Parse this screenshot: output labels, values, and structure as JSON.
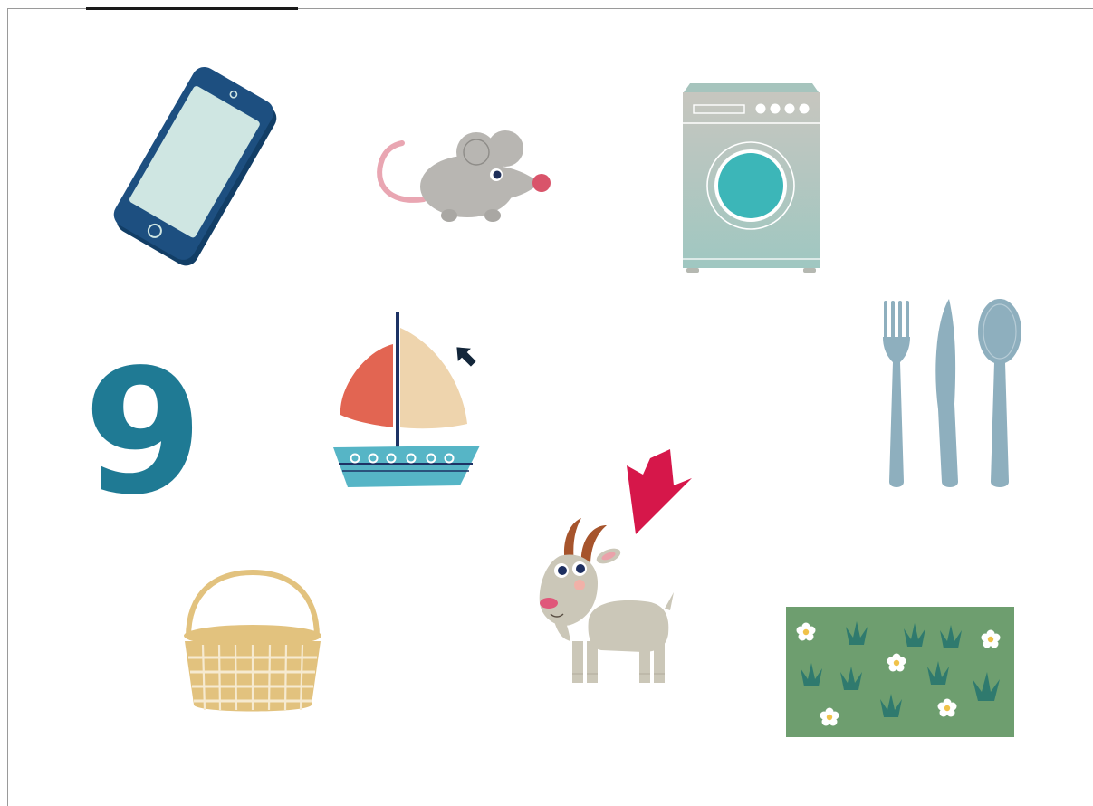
{
  "number_card": {
    "digit": "9"
  },
  "pictures": [
    {
      "name": "smartphone",
      "icon": "smartphone-icon"
    },
    {
      "name": "mouse",
      "icon": "mouse-icon"
    },
    {
      "name": "washing-machine",
      "icon": "washing-machine-icon"
    },
    {
      "name": "sailboat",
      "icon": "sailboat-icon"
    },
    {
      "name": "cutlery",
      "icon": "cutlery-icon"
    },
    {
      "name": "goat",
      "icon": "goat-icon"
    },
    {
      "name": "basket",
      "icon": "basket-icon"
    },
    {
      "name": "grass-meadow",
      "icon": "grass-meadow-icon"
    }
  ],
  "pointers": [
    {
      "name": "sail-pointer",
      "color": "#13263a"
    },
    {
      "name": "goat-pointer",
      "color": "#d6174a"
    }
  ],
  "colors": {
    "digit": "#1f7a94",
    "phone_body": "#1d4f80",
    "phone_screen": "#cfe6e2",
    "cutlery": "#8eafbe",
    "meadow": "#6e9e6f",
    "basket": "#e2c27e",
    "goat_arrow": "#d6174a"
  }
}
